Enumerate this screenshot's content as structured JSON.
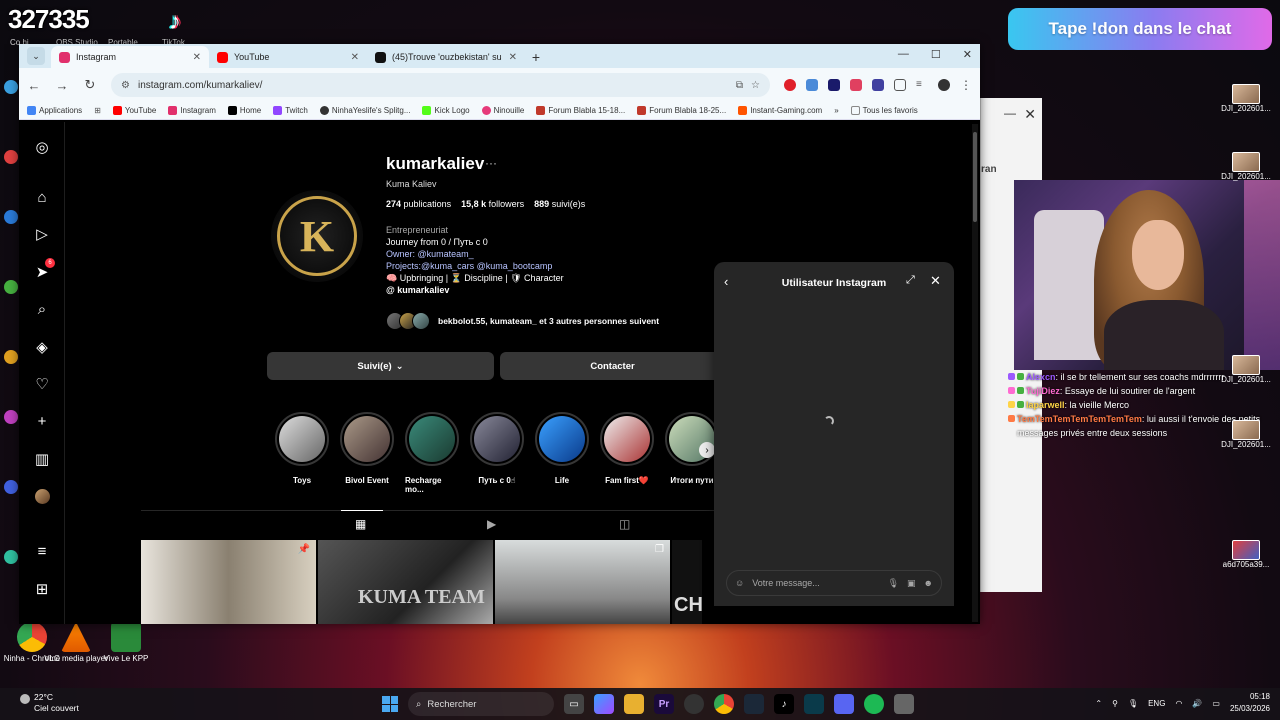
{
  "stream": {
    "counter": "327335",
    "donation_text": "Tape !don dans le chat"
  },
  "desktop": {
    "top_labels": [
      "Co hi",
      "OBS Studio",
      "Portable",
      "TikTok"
    ],
    "bottom_icons": [
      {
        "label": "Ninha - Chrome"
      },
      {
        "label": "VLC media player"
      },
      {
        "label": "Vive Le KPP"
      }
    ],
    "files": [
      {
        "label": "DJI_202601..."
      },
      {
        "label": "DJI_202601..."
      },
      {
        "label": "DJI_202601..."
      },
      {
        "label": "DJI_202601..."
      },
      {
        "label": "DJI_202601..."
      },
      {
        "label": "a6d705a39..."
      }
    ]
  },
  "background_window": {
    "partial_text": "ran"
  },
  "chat": [
    {
      "user": "Alexcn",
      "message": ": il se br tellement sur ses coachs mdrrrrrrr",
      "color": "#9b59ff"
    },
    {
      "user": "TujiDiez",
      "message": ": Essaye de lui soutirer de l'argent",
      "color": "#ff6bd1"
    },
    {
      "user": "laparwell",
      "message": ": la vieille Merco",
      "color": "#ffd447"
    },
    {
      "user": "TemTemTemTemTemTemTem",
      "message": ": lui aussi il t'envoie des petits messages privés entre deux sessions",
      "color": "#ff7a45"
    }
  ],
  "browser": {
    "tabs": [
      {
        "label": "Instagram",
        "active": true,
        "favicon_color": "#e1306c"
      },
      {
        "label": "YouTube",
        "active": false,
        "favicon_color": "#ff0000"
      },
      {
        "label": "(45)Trouve 'ouzbekistan' sur Ti...",
        "active": false,
        "favicon_color": "#111111"
      }
    ],
    "url": "instagram.com/kumarkaliev/",
    "bookmarks": [
      {
        "label": "Applications",
        "color": "#4285f4"
      },
      {
        "label": "YouTube",
        "color": "#ff0000"
      },
      {
        "label": "Instagram",
        "color": "#e1306c"
      },
      {
        "label": "Home",
        "color": "#000000"
      },
      {
        "label": "Twitch",
        "color": "#9146ff"
      },
      {
        "label": "NinhaYeslife's Splitg...",
        "color": "#333333"
      },
      {
        "label": "Kick Logo",
        "color": "#53fc18"
      },
      {
        "label": "Ninouille",
        "color": "#e63a7a"
      },
      {
        "label": "Forum Blabla 15-18...",
        "color": "#c0392b"
      },
      {
        "label": "Forum Blabla 18-25...",
        "color": "#c0392b"
      },
      {
        "label": "Instant-Gaming.com",
        "color": "#ff5400"
      },
      {
        "label": "Tous les favoris",
        "color": "#888888"
      }
    ]
  },
  "profile": {
    "username": "kumarkaliev",
    "full_name": "Kuma Kaliev",
    "stats": [
      {
        "value": "274",
        "label": "publications"
      },
      {
        "value": "15,8 k",
        "label": "followers"
      },
      {
        "value": "889",
        "label": "suivi(e)s"
      }
    ],
    "category": "Entrepreneuriat",
    "bio_lines": [
      "Journey from 0 / Путь с 0",
      "Owner: @kumateam_",
      "Projects:@kuma_cars @kuma_bootcamp",
      "🧠 Upbringing | ⏳ Discipline | 🛡 Character"
    ],
    "threads_handle": "kumarkaliev",
    "followed_by": "bekbolot.55, kumateam_ et 3 autres personnes suivent",
    "follow_button": "Suivi(e)",
    "contact_button": "Contacter",
    "highlights": [
      {
        "label": "Toys"
      },
      {
        "label": "Bivol Event"
      },
      {
        "label": "Recharge mo..."
      },
      {
        "label": "Путь с 0☝"
      },
      {
        "label": "Life"
      },
      {
        "label": "Fam first❤️"
      },
      {
        "label": "Итоги пути"
      }
    ],
    "post_text": "KUMA TEAM",
    "post_text_2": "CHALLENGE"
  },
  "dm": {
    "title": "Utilisateur Instagram",
    "placeholder": "Votre message..."
  },
  "taskbar": {
    "temperature": "22°C",
    "weather": "Ciel couvert",
    "search": "Rechercher",
    "language": "ENG",
    "time": "05:18",
    "date": "25/03/2026"
  }
}
